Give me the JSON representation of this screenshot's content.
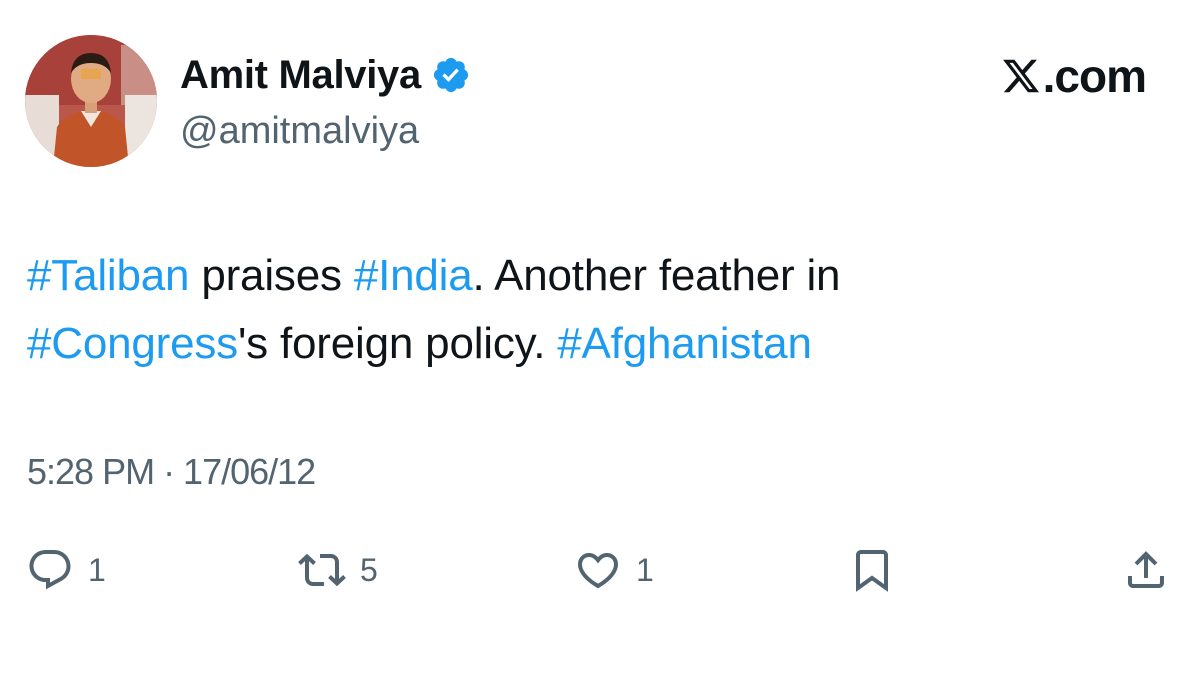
{
  "author": {
    "name": "Amit Malviya",
    "handle": "@amitmalviya",
    "verified": true,
    "avatar": "profile-photo"
  },
  "brand": {
    "text": ".com",
    "logo": "x-logo-icon"
  },
  "tweet": {
    "segments": [
      {
        "text": "#Taliban",
        "hashtag": true
      },
      {
        "text": " praises ",
        "hashtag": false
      },
      {
        "text": "#India",
        "hashtag": true
      },
      {
        "text": ". Another feather in ",
        "hashtag": false
      },
      {
        "text": "#Congress",
        "hashtag": true
      },
      {
        "text": "'s foreign policy. ",
        "hashtag": false
      },
      {
        "text": "#Afghanistan",
        "hashtag": true
      }
    ]
  },
  "timestamp": "5:28 PM · 17/06/12",
  "actions": {
    "reply": {
      "icon": "reply-icon",
      "count": "1"
    },
    "retweet": {
      "icon": "retweet-icon",
      "count": "5"
    },
    "like": {
      "icon": "heart-icon",
      "count": "1"
    },
    "bookmark": {
      "icon": "bookmark-icon"
    },
    "share": {
      "icon": "share-icon"
    }
  },
  "colors": {
    "hashtag": "#1d9bf0",
    "verified": "#1d9bf0",
    "text": "#0f1419",
    "secondary": "#536471",
    "background": "#ffffff"
  }
}
